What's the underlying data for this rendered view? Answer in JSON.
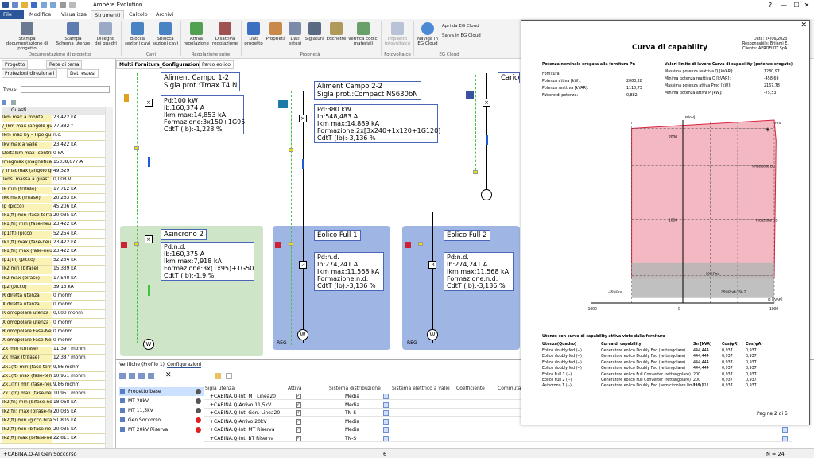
{
  "app": {
    "title": "Ampère Evolution"
  },
  "window": {
    "minimize": "—",
    "maximize": "☐",
    "close": "✕",
    "help": "?"
  },
  "menu_tabs": [
    "File",
    "Modifica",
    "Visualizza",
    "Strumenti",
    "Calcolo",
    "Archivi"
  ],
  "ribbon": {
    "buttons": [
      "Stampa documentazione di progetto",
      "Stampa Schema utenze",
      "Disegno dei quadri",
      "Blocca sezioni cavi",
      "Sblocca sezioni cavi",
      "Attiva regolazione",
      "Disattiva regolazione",
      "Dati progetto",
      "Proprietà",
      "Dati estesi",
      "Siglatura",
      "Etichette",
      "Verifica codici materiali",
      "Impianto fotovoltaico",
      "Naviga in EG Cloud",
      "Apri da EG Cloud",
      "Salva in EG Cloud"
    ],
    "groups": [
      "Documentazione di progetto",
      "Cavi",
      "Regolazione spire",
      "Proprietà",
      "Fotovoltaico",
      "EG Cloud"
    ]
  },
  "left_panel": {
    "tabs": [
      "Progetto",
      "Rete di terra",
      "Protezioni direzionali",
      "Dati estesi"
    ],
    "filter_label": "Trova:",
    "section": "Guasti",
    "rows": [
      [
        "Ikm max a monte",
        "23,422 kA"
      ],
      [
        "/_Ikm max (angolo gu",
        "77,382 °"
      ],
      [
        "Ikm max by - Tipo gu",
        "n.c."
      ],
      [
        "Ikv max a valle",
        "23,422 kA"
      ],
      [
        "Deltalkm max (contril",
        "0 kA"
      ],
      [
        "Imagmax (magnetica",
        "15338,677 A"
      ],
      [
        "/_Imagmax (angolo gu",
        "49,329 °"
      ],
      [
        "Tens. massa a guast",
        "0,008 V"
      ],
      [
        "Ik min (trifase)",
        "17,712 kA"
      ],
      [
        "Ikk max (trifase)",
        "20,263 kA"
      ],
      [
        "Ip (picco)",
        "45,206 kA"
      ],
      [
        "Ik1(ft) min (fase-terra",
        "20,035 kA"
      ],
      [
        "Ik1(fn) min (fase-neu",
        "23,422 kA"
      ],
      [
        "Ip1(ft) (picco)",
        "52,254 kA"
      ],
      [
        "Ik1(ft) max (fase-neu",
        "23,422 kA"
      ],
      [
        "Ik1(fn) max (fase-neu",
        "23,422 kA"
      ],
      [
        "Ip1(fn) (picco)",
        "52,254 kA"
      ],
      [
        "Ik2 min (bifase)",
        "15,339 kA"
      ],
      [
        "Ik2 max (bifase)",
        "17,548 kA"
      ],
      [
        "Ip2 (picco)",
        "39,15 kA"
      ],
      [
        "R diretta utenza",
        "0 mohm"
      ],
      [
        "X diretta utenza",
        "0 mohm"
      ],
      [
        "R omopolare utenza",
        "0,000 mohm"
      ],
      [
        "X omopolare utenza",
        "0 mohm"
      ],
      [
        "R omopolare Fase-Ne",
        "0 mohm"
      ],
      [
        "X omopolare Fase-Ne",
        "0 mohm"
      ],
      [
        "Zk min (trifase)",
        "11,397 mohm"
      ],
      [
        "Zk max (trifase)",
        "12,387 mohm"
      ],
      [
        "Zk1(ft) min (fase-terr",
        "9,86 mohm"
      ],
      [
        "Zk1(ft) max (fase-terr",
        "10,951 mohm"
      ],
      [
        "Zk1(fn) min (fase-neu",
        "9,86 mohm"
      ],
      [
        "Zk1(fn) max (fase-neu",
        "10,951 mohm"
      ],
      [
        "Ik2(fn) min (bifase-ne",
        "18,068 kA"
      ],
      [
        "Ik2(fn) max (bifase-ne",
        "20,035 kA"
      ],
      [
        "Ik2(ft) min (gicco bifase-n",
        "51,805 kA"
      ],
      [
        "Ik2(ft) min (bifase-ne",
        "20,035 kA"
      ],
      [
        "Ik2(ft) max (bifase-ne",
        "22,811 kA"
      ]
    ]
  },
  "doc_tabs": [
    "Multi Fornitura_Configurazioni",
    "Parco eolico"
  ],
  "diagram": {
    "titles": [
      [
        "Aliment Campo 1-2",
        "Sigla prot.:Tmax T4 N"
      ],
      [
        "Aliment Campo 2-2",
        "Sigla prot.:Compact NS630bN"
      ],
      [
        "Carico"
      ]
    ],
    "info_top": [
      [
        "Pd:100 kW",
        "Ib:160,374 A",
        "Ikm max:14,853 kA",
        "Formazione:3x150+1G95",
        "CdtT (Ib):-1,228 %"
      ],
      [
        "Pd:380 kW",
        "Ib:548,483 A",
        "Ikm max:14,889 kA",
        "Formazione:2x[3x240+1x120+1G120]",
        "CdtT (Ib):-3,136 %"
      ]
    ],
    "zones": [
      "Asincrono 2",
      "Eolico Full 1",
      "Eolico Full 2"
    ],
    "info_bottom": [
      [
        "Pd:n.d.",
        "Ib:160,375 A",
        "Ikm max:7,918 kA",
        "Formazione:3x(1x95)+1G50",
        "CdtT (Ib):-1,9 %"
      ],
      [
        "Pd:n.d.",
        "Ib:274,241 A",
        "Ikm max:11,568 kA",
        "Formazione:n.d.",
        "CdtT (Ib):-3,136 %"
      ],
      [
        "Pd:n.d.",
        "Ib:274,241 A",
        "Ikm max:11,568 kA",
        "Formazione:n.d.",
        "CdtT (Ib):-3,136 %"
      ]
    ],
    "reg_label": "REG",
    "motor_label": "W"
  },
  "bottom": {
    "tabs": [
      "Verifiche (Profilo 1)",
      "Configurazioni"
    ],
    "headers": [
      "Sigla utenza",
      "Attiva",
      "Sistema distribuzione",
      "Sistema elettrico a valle",
      "Coefficiente",
      "Commutat"
    ],
    "configs": [
      "Progetto base",
      "MT 20kV",
      "MT 11,5kV",
      "Gen Soccorso",
      "MT 20kV Riserva"
    ],
    "config_colors": [
      "#555555",
      "#555555",
      "#555555",
      "#e02020",
      "#e02020"
    ],
    "rows": [
      [
        "+CABINA.Q-Int. MT Linea20",
        "Media"
      ],
      [
        "+CABINA.Q-Arrivo 11,5kV",
        "Media"
      ],
      [
        "+CABINA.Q-Int. Gen. Linea20",
        "TN-S"
      ],
      [
        "+CABINA.Q-Arrivo 20kV",
        "Media"
      ],
      [
        "+CABINA.Q-Int. MT Riserva",
        "Media"
      ],
      [
        "+CABINA.Q-Int. BT Riserva",
        "TN-S"
      ]
    ]
  },
  "status": {
    "left": "+CABINA.Q-AI Gen Soccorso",
    "mid": "6",
    "right": "N = 24"
  },
  "preview": {
    "title": "Curva di capability",
    "header_info": [
      "Data: 24/06/2023",
      "Responsabile: Brijami E.",
      "Cliente: AEROFLOT SpA"
    ],
    "left_head": "Potenza nominale erogata alla fornitura Pn",
    "left_rows": [
      [
        "Fornitura:",
        ""
      ],
      [
        "Potenza attiva [kW]:",
        "2083,28"
      ],
      [
        "Potenza reattiva [kVAR]:",
        "1110,73"
      ],
      [
        "Fattore di potenza:",
        "0,882"
      ]
    ],
    "right_head": "Valori limite di lavoro Curva di capability (potenze erogate)",
    "right_rows": [
      [
        "Massima potenza reattiva Q [kVAR]:",
        "1280,97"
      ],
      [
        "Minima potenza reattiva Q [kVAR]:",
        "-458,69"
      ],
      [
        "Massima potenza attiva Pmd [kW]:",
        "2167,78"
      ],
      [
        "Minima potenza attiva P [kW]:",
        "-75,53"
      ]
    ],
    "chart_labels": {
      "p_axis": "P[kW]",
      "q_axis": "Q [kVAR]",
      "pnd": "Pnd",
      "pn": "Pn",
      "prot_bc": "Proiezione BC",
      "rid_rs": "Riduzione RS",
      "pct20": "20%Pnd",
      "pct35n": "-35%Pnd",
      "pct35": "35%Pnd=758,7"
    },
    "chart_data": {
      "type": "area",
      "xlim": [
        -1000,
        1000
      ],
      "ylim": [
        0,
        2200
      ],
      "x_ticks": [
        "-1000",
        "0",
        "1000"
      ],
      "y_ticks": [
        "1000",
        "2000"
      ]
    },
    "table_title": "Utenze con curva di capability attiva viste dalla fornitura",
    "table_headers": [
      "Utenza(Quadro)",
      "Curva di capability",
      "Sn [kVA]",
      "Cos(φR)",
      "Cos(φA)"
    ],
    "table_rows": [
      [
        "Eolico doubly fed (--)",
        "Generatore eolico Doubly Fed (rettangolare)",
        "444,444",
        "0,937",
        "0,937"
      ],
      [
        "Eolico doubly fed (--)",
        "Generatore eolico Doubly Fed (rettangolare)",
        "444,444",
        "0,937",
        "0,937"
      ],
      [
        "Eolico doubly fed (--)",
        "Generatore eolico Doubly Fed (rettangolare)",
        "444,444",
        "0,937",
        "0,937"
      ],
      [
        "Eolico doubly fed (--)",
        "Generatore eolico Doubly Fed (rettangolare)",
        "444,444",
        "0,937",
        "0,937"
      ],
      [
        "Eolico Full 1 (--)",
        "Generatore eolico Full Converter (rettangolare)",
        "200",
        "0,937",
        "0,937"
      ],
      [
        "Eolico Full 2 (--)",
        "Generatore eolico Full Converter (rettangolare)",
        "200",
        "0,937",
        "0,937"
      ],
      [
        "Asincrono 1 (--)",
        "Generatore eolico Doubly Fed (semicircolare limitata)",
        "111,111",
        "0,937",
        "0,937"
      ]
    ],
    "footer": "Pagina 2 di 5"
  }
}
